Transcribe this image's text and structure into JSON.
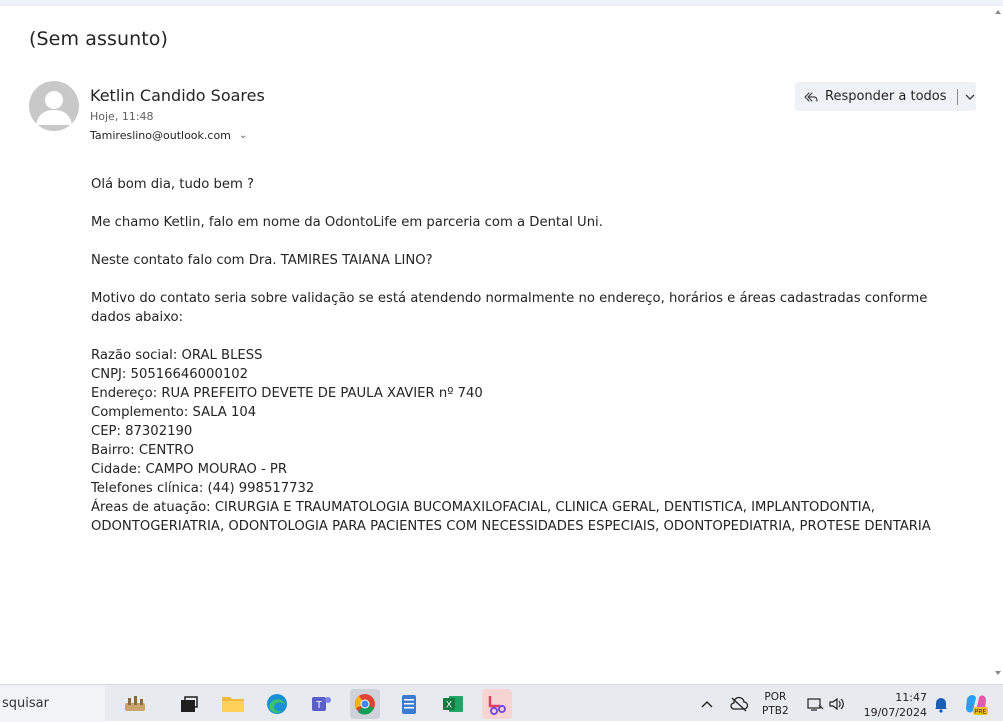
{
  "email": {
    "subject": "(Sem assunto)",
    "sender_name": "Ketlin Candido Soares",
    "time": "Hoje, 11:48",
    "recipient": "Tamireslino@outlook.com",
    "reply_all_label": "Responder a todos",
    "body": {
      "greeting": "Olá bom dia, tudo bem ?",
      "intro": "Me chamo Ketlin, falo em nome da OdontoLife em parceria com a Dental Uni.",
      "question": "Neste contato falo com Dra. TAMIRES TAIANA LINO?",
      "motive": "Motivo do contato seria sobre validação se está atendendo normalmente no endereço, horários e áreas cadastradas conforme dados abaixo:",
      "details": [
        "Razão social: ORAL BLESS",
        "CNPJ: 50516646000102",
        "Endereço: RUA PREFEITO DEVETE DE PAULA XAVIER nº 740",
        "Complemento: SALA 104",
        "CEP: 87302190",
        "Bairro: CENTRO",
        "Cidade: CAMPO MOURAO - PR",
        "Telefones clínica: (44) 998517732",
        "Áreas de atuação: CIRURGIA E TRAUMATOLOGIA BUCOMAXILOFACIAL, CLINICA GERAL, DENTISTICA, IMPLANTODONTIA, ODONTOGERIATRIA, ODONTOLOGIA PARA PACIENTES COM NECESSIDADES ESPECIAIS, ODONTOPEDIATRIA, PROTESE DENTARIA"
      ]
    }
  },
  "taskbar": {
    "search_text": "squisar",
    "apps": [
      "widgets-icon",
      "task-view-icon",
      "file-explorer-icon",
      "edge-icon",
      "teams-icon",
      "chrome-icon",
      "notepad-icon",
      "excel-icon",
      "snipping-tool-icon"
    ],
    "lang_top": "POR",
    "lang_bottom": "PTB2",
    "time": "11:47",
    "date": "19/07/2024",
    "copilot_badge": "PRE"
  }
}
